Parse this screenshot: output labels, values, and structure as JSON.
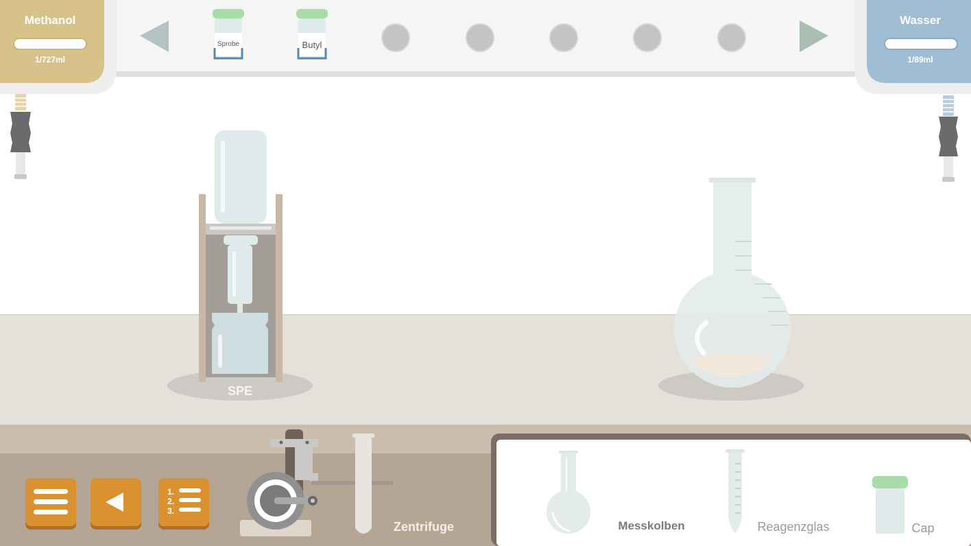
{
  "reservoirs": {
    "left": {
      "name": "Methanol",
      "level": "1/727ml",
      "color": "#d7c38a"
    },
    "right": {
      "name": "Wasser",
      "level": "1/89ml",
      "color": "#9fbdd3"
    }
  },
  "shelf": {
    "items": [
      {
        "label": "Sprobe",
        "cap_color": "#a8dca8"
      },
      {
        "label": "Butyl",
        "cap_color": "#a8dca8"
      }
    ],
    "empty_slots": 5
  },
  "bench": {
    "spe_label": "SPE"
  },
  "bottom_bar": {
    "buttons": [
      "menu-icon",
      "back-icon",
      "numbered-list-icon"
    ],
    "accent": "#d9922f",
    "device_label": "Zentrifuge"
  },
  "inventory": {
    "items": [
      {
        "label": "Messkolben",
        "icon": "volumetric-flask-icon"
      },
      {
        "label": "Reagenzglas",
        "icon": "test-tube-icon"
      },
      {
        "label": "Cap",
        "icon": "cap-vial-icon"
      }
    ]
  }
}
